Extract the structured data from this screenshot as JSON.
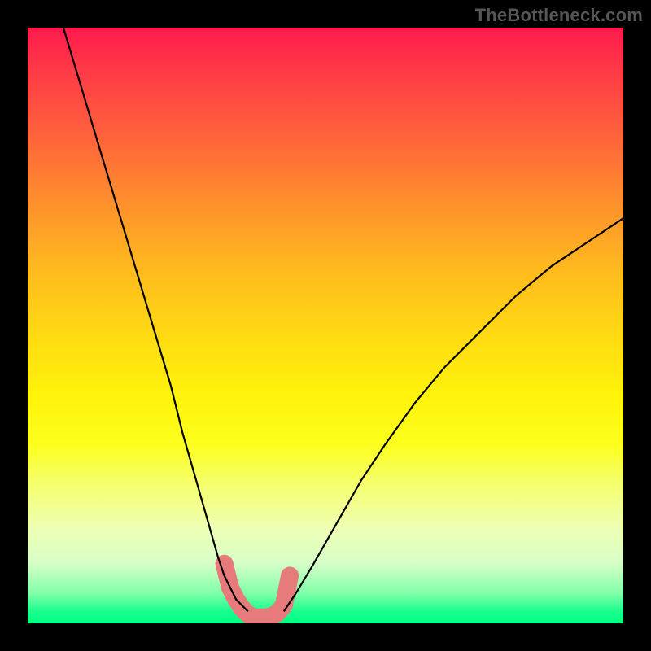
{
  "watermark": "TheBottleneck.com",
  "chart_data": {
    "type": "line",
    "title": "",
    "xlabel": "",
    "ylabel": "",
    "xlim": [
      0,
      100
    ],
    "ylim": [
      0,
      100
    ],
    "grid": false,
    "legend": false,
    "series": [
      {
        "name": "left-branch",
        "x": [
          6,
          9,
          12,
          15,
          18,
          21,
          24,
          26,
          28,
          30,
          32,
          33,
          34,
          35,
          36,
          37
        ],
        "y": [
          100,
          90,
          80,
          70,
          60,
          50,
          40,
          32,
          25,
          18,
          11,
          8,
          6,
          4,
          3,
          2
        ],
        "stroke": "#000000",
        "width": 2.2
      },
      {
        "name": "right-branch",
        "x": [
          43,
          45,
          48,
          52,
          56,
          60,
          65,
          70,
          76,
          82,
          88,
          94,
          100
        ],
        "y": [
          2,
          5,
          10,
          17,
          24,
          30,
          37,
          43,
          49,
          55,
          60,
          64,
          68
        ],
        "stroke": "#000000",
        "width": 2.2
      },
      {
        "name": "sweet-spot-markers",
        "x": [
          33,
          34,
          35,
          36,
          37,
          38,
          39,
          40,
          41,
          42,
          43,
          44
        ],
        "y": [
          10,
          6,
          4,
          2.5,
          1.5,
          1,
          1,
          1,
          1.2,
          1.8,
          3,
          8
        ],
        "stroke": "#e77b7b",
        "width": 18,
        "cap": "round"
      }
    ],
    "gradient_stops": [
      {
        "pos": 0,
        "color": "#ff1a4d"
      },
      {
        "pos": 50,
        "color": "#ffdb12"
      },
      {
        "pos": 100,
        "color": "#00ff85"
      }
    ]
  }
}
